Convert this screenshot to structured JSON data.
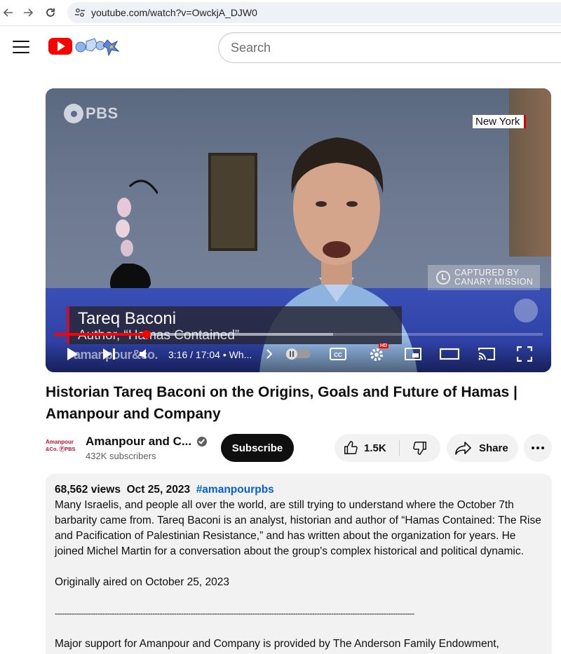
{
  "browser": {
    "url": "youtube.com/watch?v=OwckjA_DJW0"
  },
  "header": {
    "search_placeholder": "Search"
  },
  "player": {
    "network_logo": "PBS",
    "location_tag": "New York",
    "capture_badge_line1": "CAPTURED BY",
    "capture_badge_line2": "CANARY MISSION",
    "lower_third_name": "Tareq Baconi",
    "lower_third_role": "Author, “Hamas Contained”",
    "watermark": "amanpour&co.",
    "time_display": "3:16 / 17:04",
    "chapter": "• Wh...",
    "progress_fraction": 0.19,
    "hd_badge": "HD",
    "cc_label": "CC"
  },
  "video": {
    "title": "Historian Tareq Baconi on the Origins, Goals and Future of Hamas | Amanpour and Company"
  },
  "channel": {
    "logo_line1": "Amanpour",
    "logo_line2": "&Co. ⓅPBS",
    "name": "Amanpour and C...",
    "subscribers": "432K subscribers",
    "subscribe_label": "Subscribe"
  },
  "actions": {
    "like_count": "1.5K",
    "share_label": "Share"
  },
  "description": {
    "views": "68,562 views",
    "date": "Oct 25, 2023",
    "hashtag": "#amanpourpbs",
    "paragraph": "Many Israelis, and people all over the world, are still trying to understand where the October 7th barbarity came from. Tareq Baconi is an analyst, historian and author of “Hamas Contained: The Rise and Pacification of Palestinian Resistance,” and has written about the organization for years. He joined Michel Martin for a conversation about the group's complex historical and political dynamic.",
    "aired": "Originally aired on October 25, 2023",
    "divider": "-------------------------------------------------------------------------------------------------------------------------------------------------------",
    "support": "Major support for Amanpour and Company is provided by The Anderson Family Endowment, Candace"
  },
  "colors": {
    "brand_red": "#ff0000",
    "hashtag_blue": "#065fd4",
    "chip_bg": "#f2f2f2"
  }
}
